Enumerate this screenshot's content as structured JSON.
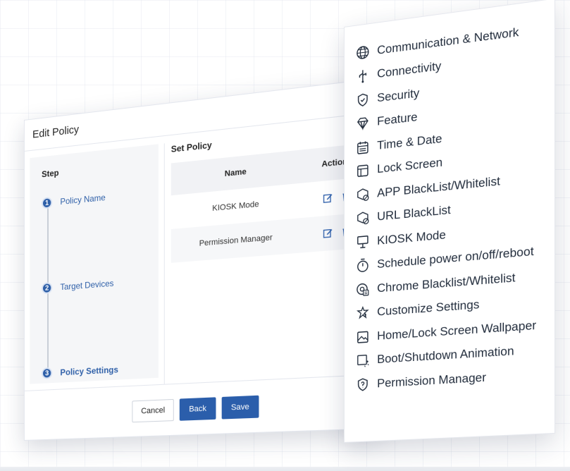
{
  "dialog": {
    "title": "Edit Policy",
    "steps_title": "Step",
    "steps": [
      {
        "number": "1",
        "label": "Policy Name"
      },
      {
        "number": "2",
        "label": "Target Devices"
      },
      {
        "number": "3",
        "label": "Policy Settings"
      }
    ],
    "set_policy_title": "Set Policy",
    "table": {
      "headers": {
        "name": "Name",
        "actions": "Actions"
      },
      "rows": [
        {
          "name": "KIOSK Mode"
        },
        {
          "name": "Permission Manager"
        }
      ]
    },
    "footer": {
      "cancel": "Cancel",
      "back": "Back",
      "save": "Save"
    }
  },
  "menu": {
    "items": [
      {
        "icon": "globe-icon",
        "label": "Communication & Network"
      },
      {
        "icon": "usb-icon",
        "label": "Connectivity"
      },
      {
        "icon": "shield-check-icon",
        "label": "Security"
      },
      {
        "icon": "diamond-icon",
        "label": "Feature"
      },
      {
        "icon": "calendar-icon",
        "label": "Time & Date"
      },
      {
        "icon": "lock-screen-layout-icon",
        "label": "Lock Screen"
      },
      {
        "icon": "app-block-icon",
        "label": "APP BlackList/Whitelist"
      },
      {
        "icon": "url-block-icon",
        "label": "URL BlackList"
      },
      {
        "icon": "kiosk-icon",
        "label": "KIOSK Mode"
      },
      {
        "icon": "timer-icon",
        "label": "Schedule power on/off/reboot"
      },
      {
        "icon": "chrome-list-icon",
        "label": "Chrome Blacklist/Whitelist"
      },
      {
        "icon": "customize-icon",
        "label": "Customize Settings"
      },
      {
        "icon": "wallpaper-icon",
        "label": "Home/Lock Screen Wallpaper"
      },
      {
        "icon": "boot-animation-icon",
        "label": "Boot/Shutdown Animation"
      },
      {
        "icon": "permission-shield-icon",
        "label": "Permission Manager"
      }
    ]
  },
  "colors": {
    "accent": "#2b5eab",
    "step_line": "#9aa4b4"
  }
}
